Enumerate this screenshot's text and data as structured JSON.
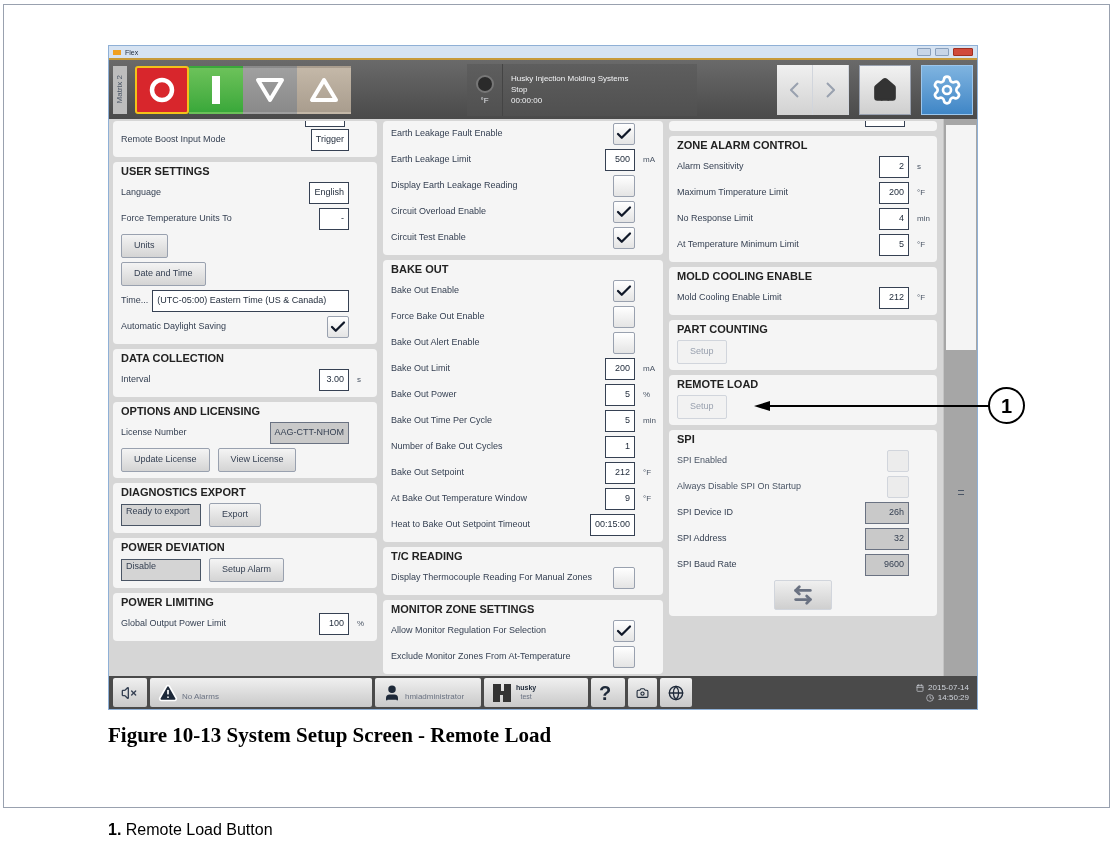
{
  "window": {
    "title": "Flex"
  },
  "toolbar": {
    "tab": "Matrix 2",
    "controls": [
      {
        "kind": "stop",
        "selected": true
      },
      {
        "kind": "start",
        "selected": false
      },
      {
        "kind": "down",
        "selected": false
      },
      {
        "kind": "up",
        "selected": false
      }
    ],
    "status": {
      "unit": "°F",
      "lines": [
        "Husky Injection Molding Systems",
        "Stop",
        "00:00:00"
      ]
    },
    "nav": [
      {
        "kind": "back",
        "disabled": true
      },
      {
        "kind": "forward",
        "disabled": true
      }
    ],
    "views": [
      {
        "kind": "home",
        "selected": false
      },
      {
        "kind": "settings",
        "selected": true
      }
    ]
  },
  "columns": [
    {
      "sections": [
        {
          "rows": [
            {
              "kind": "cut_field"
            },
            {
              "kind": "field",
              "label": "Remote Boost Input Mode",
              "value": "Trigger",
              "readonly": false
            }
          ]
        },
        {
          "title": "USER SETTINGS",
          "rows": [
            {
              "kind": "field",
              "label": "Language",
              "value": "English",
              "readonly": false
            },
            {
              "kind": "field",
              "label": "Force Temperature Units To",
              "value": "-",
              "readonly": false
            },
            {
              "kind": "buttons",
              "buttons": [
                {
                  "label": "Units",
                  "disabled": false
                }
              ]
            },
            {
              "kind": "buttons",
              "buttons": [
                {
                  "label": "Date and Time",
                  "disabled": false
                }
              ]
            },
            {
              "kind": "wide_field",
              "label": "Time...",
              "value": "(UTC-05:00) Eastern Time (US & Canada)"
            },
            {
              "kind": "check",
              "label": "Automatic Daylight Saving",
              "checked": true,
              "disabled": false
            }
          ]
        },
        {
          "title": "DATA COLLECTION",
          "rows": [
            {
              "kind": "field",
              "label": "Interval",
              "value": "3.00",
              "unit": "s",
              "readonly": false
            }
          ]
        },
        {
          "title": "OPTIONS AND LICENSING",
          "rows": [
            {
              "kind": "field",
              "label": "License Number",
              "value": "AAG-CTT-NHOM",
              "readonly": true
            },
            {
              "kind": "buttons",
              "buttons": [
                {
                  "label": "Update License",
                  "disabled": false
                },
                {
                  "label": "View License",
                  "disabled": false
                }
              ]
            }
          ]
        },
        {
          "title": "DIAGNOSTICS EXPORT",
          "rows": [
            {
              "kind": "field_button",
              "value": "Ready to export",
              "button": "Export"
            }
          ]
        },
        {
          "title": "POWER DEVIATION",
          "rows": [
            {
              "kind": "field_button",
              "value": "Disable",
              "button": "Setup Alarm"
            }
          ]
        },
        {
          "title": "POWER LIMITING",
          "rows": [
            {
              "kind": "field",
              "label": "Global Output Power Limit",
              "value": "100",
              "unit": "%",
              "readonly": false
            }
          ]
        }
      ]
    },
    {
      "sections": [
        {
          "rows": [
            {
              "kind": "check",
              "label": "Earth Leakage Fault Enable",
              "checked": true,
              "disabled": false
            },
            {
              "kind": "field",
              "label": "Earth Leakage Limit",
              "value": "500",
              "unit": "mA",
              "readonly": false
            },
            {
              "kind": "check",
              "label": "Display Earth Leakage Reading",
              "checked": false,
              "disabled": false
            },
            {
              "kind": "check",
              "label": "Circuit Overload Enable",
              "checked": true,
              "disabled": false
            },
            {
              "kind": "check",
              "label": "Circuit Test Enable",
              "checked": true,
              "disabled": false
            }
          ]
        },
        {
          "title": "BAKE OUT",
          "rows": [
            {
              "kind": "check",
              "label": "Bake Out Enable",
              "checked": true,
              "disabled": false
            },
            {
              "kind": "check",
              "label": "Force Bake Out Enable",
              "checked": false,
              "disabled": false
            },
            {
              "kind": "check",
              "label": "Bake Out Alert Enable",
              "checked": false,
              "disabled": false
            },
            {
              "kind": "field",
              "label": "Bake Out Limit",
              "value": "200",
              "unit": "mA",
              "readonly": false
            },
            {
              "kind": "field",
              "label": "Bake Out Power",
              "value": "5",
              "unit": "%",
              "readonly": false
            },
            {
              "kind": "field",
              "label": "Bake Out Time Per Cycle",
              "value": "5",
              "unit": "min",
              "readonly": false
            },
            {
              "kind": "field",
              "label": "Number of Bake Out Cycles",
              "value": "1",
              "readonly": false
            },
            {
              "kind": "field",
              "label": "Bake Out Setpoint",
              "value": "212",
              "unit": "°F",
              "readonly": false
            },
            {
              "kind": "field",
              "label": "At Bake Out Temperature Window",
              "value": "9",
              "unit": "°F",
              "readonly": false
            },
            {
              "kind": "field",
              "label": "Heat to Bake Out Setpoint Timeout",
              "value": "00:15:00",
              "readonly": false
            }
          ]
        },
        {
          "title": "T/C READING",
          "rows": [
            {
              "kind": "check",
              "label": "Display Thermocouple Reading For Manual Zones",
              "checked": false,
              "disabled": false
            }
          ]
        },
        {
          "title": "MONITOR ZONE SETTINGS",
          "rows": [
            {
              "kind": "check",
              "label": "Allow Monitor Regulation For Selection",
              "checked": true,
              "disabled": false
            },
            {
              "kind": "check",
              "label": "Exclude Monitor Zones From At-Temperature",
              "checked": false,
              "disabled": false
            }
          ]
        }
      ]
    },
    {
      "sections": [
        {
          "rows": [
            {
              "kind": "cut_field"
            }
          ]
        },
        {
          "title": "ZONE ALARM CONTROL",
          "rows": [
            {
              "kind": "field",
              "label": "Alarm Sensitivity",
              "value": "2",
              "unit": "s",
              "readonly": false
            },
            {
              "kind": "field",
              "label": "Maximum Timperature Limit",
              "value": "200",
              "unit": "°F",
              "readonly": false
            },
            {
              "kind": "field",
              "label": "No Response Limit",
              "value": "4",
              "unit": "min",
              "readonly": false
            },
            {
              "kind": "field",
              "label": "At Temperature Minimum Limit",
              "value": "5",
              "unit": "°F",
              "readonly": false
            }
          ]
        },
        {
          "title": "MOLD COOLING ENABLE",
          "rows": [
            {
              "kind": "field",
              "label": "Mold Cooling Enable Limit",
              "value": "212",
              "unit": "°F",
              "readonly": false
            }
          ]
        },
        {
          "title": "PART COUNTING",
          "rows": [
            {
              "kind": "buttons",
              "buttons": [
                {
                  "label": "Setup",
                  "disabled": true
                }
              ]
            }
          ]
        },
        {
          "title": "REMOTE LOAD",
          "rows": [
            {
              "kind": "buttons",
              "buttons": [
                {
                  "label": "Setup",
                  "disabled": true
                }
              ]
            }
          ]
        },
        {
          "title": "SPI",
          "rows": [
            {
              "kind": "check",
              "label": "SPI Enabled",
              "checked": false,
              "disabled": true
            },
            {
              "kind": "check",
              "label": "Always Disable SPI On Startup",
              "checked": false,
              "disabled": true
            },
            {
              "kind": "field",
              "label": "SPI Device ID",
              "value": "26h",
              "readonly": true
            },
            {
              "kind": "field",
              "label": "SPI Address",
              "value": "32",
              "readonly": true
            },
            {
              "kind": "field",
              "label": "SPI Baud Rate",
              "value": "9600",
              "readonly": true
            },
            {
              "kind": "swap_button"
            }
          ]
        }
      ]
    }
  ],
  "status_bar": {
    "items": [
      {
        "kind": "mute"
      },
      {
        "kind": "alarm",
        "label": "No Alarms"
      },
      {
        "kind": "user",
        "label": "hmiadministrator"
      },
      {
        "kind": "mold",
        "lines": [
          "husky",
          "test"
        ]
      },
      {
        "kind": "help",
        "label": "?"
      },
      {
        "kind": "screenshot"
      },
      {
        "kind": "language"
      }
    ],
    "date": "2015-07-14",
    "time": "14:50:29"
  },
  "callout": {
    "number": "1"
  },
  "caption": "Figure 10-13 System Setup Screen - Remote Load",
  "legend": [
    "**1.** Remote Load Button"
  ]
}
